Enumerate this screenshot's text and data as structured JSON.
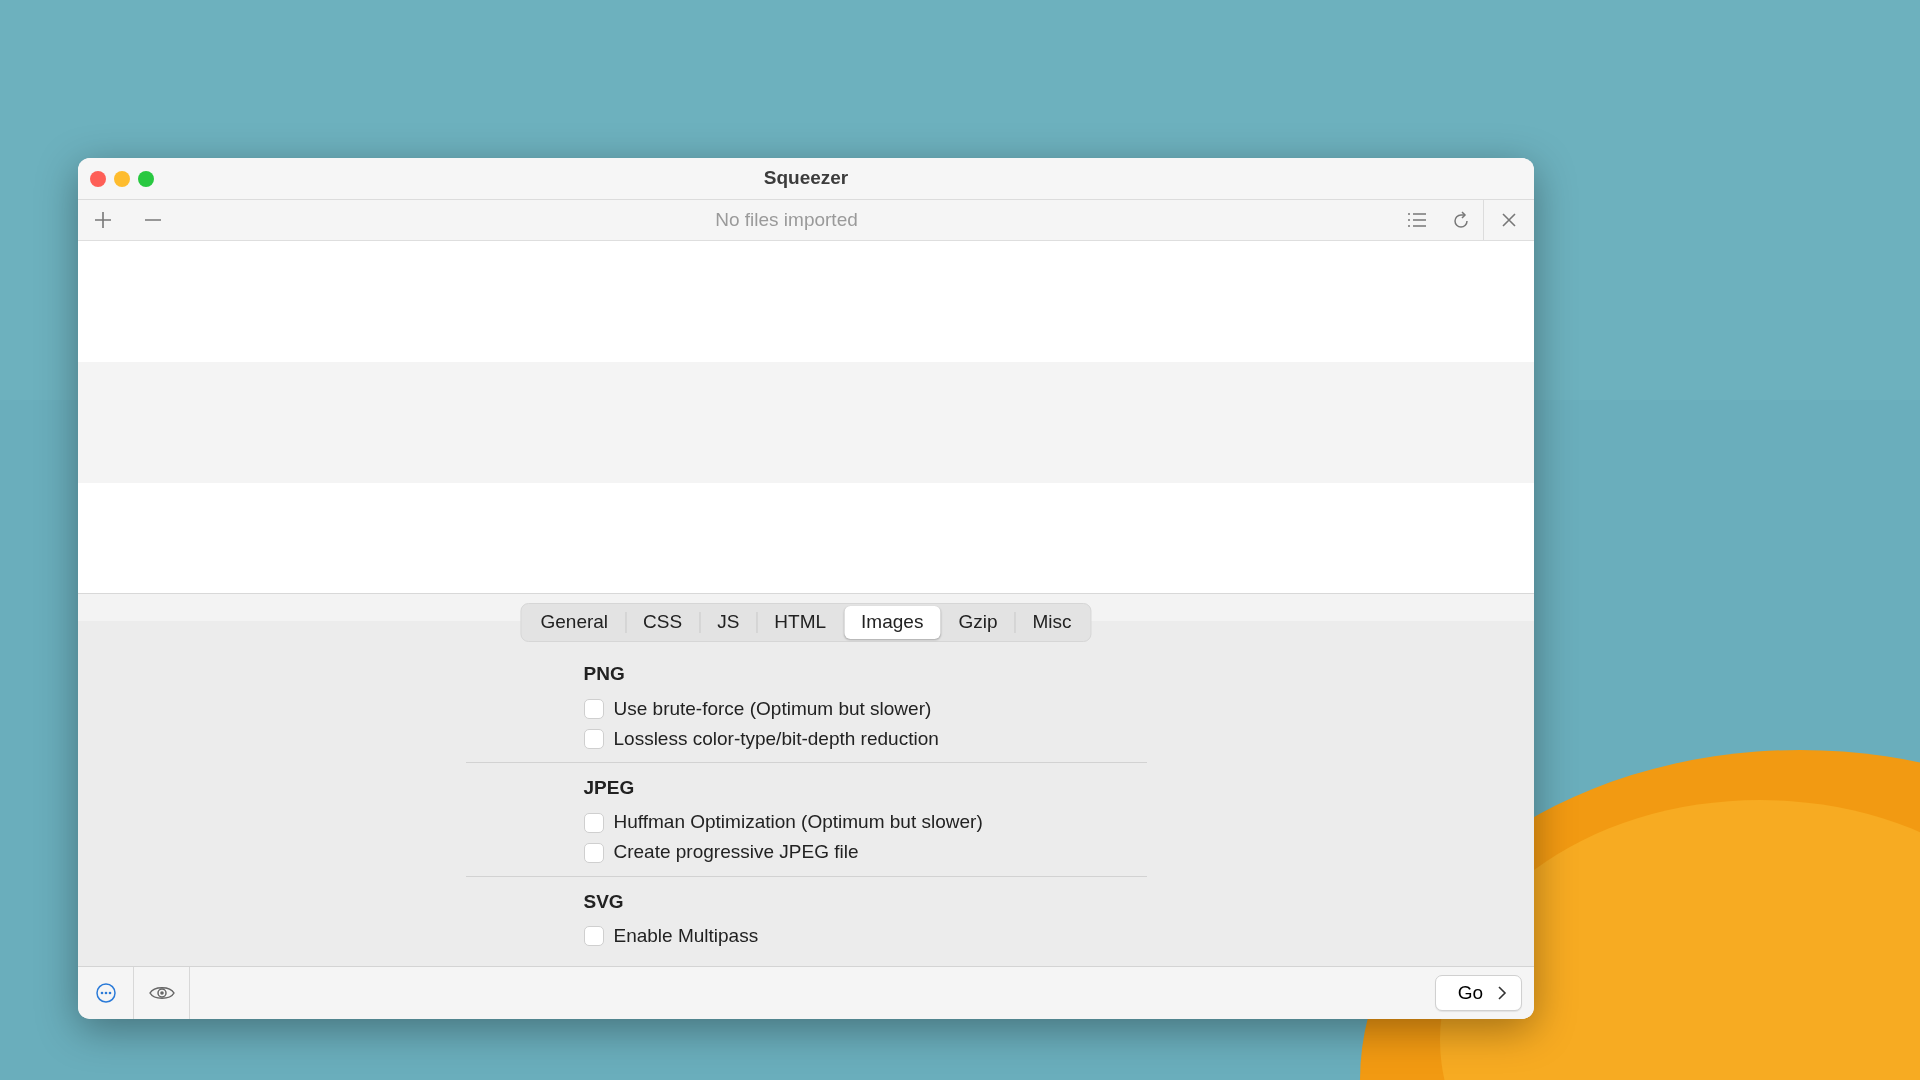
{
  "window": {
    "title": "Squeezer"
  },
  "toolbar": {
    "status": "No files imported"
  },
  "tabs": [
    {
      "label": "General",
      "selected": false
    },
    {
      "label": "CSS",
      "selected": false
    },
    {
      "label": "JS",
      "selected": false
    },
    {
      "label": "HTML",
      "selected": false
    },
    {
      "label": "Images",
      "selected": true
    },
    {
      "label": "Gzip",
      "selected": false
    },
    {
      "label": "Misc",
      "selected": false
    }
  ],
  "sections": [
    {
      "title": "PNG",
      "options": [
        {
          "label": "Use brute-force (Optimum but slower)",
          "checked": false
        },
        {
          "label": "Lossless color-type/bit-depth reduction",
          "checked": false
        }
      ]
    },
    {
      "title": "JPEG",
      "options": [
        {
          "label": "Huffman Optimization (Optimum but slower)",
          "checked": false
        },
        {
          "label": "Create progressive JPEG file",
          "checked": false
        }
      ]
    },
    {
      "title": "SVG",
      "options": [
        {
          "label": "Enable Multipass",
          "checked": false
        }
      ]
    }
  ],
  "footer": {
    "go_button": "Go"
  }
}
